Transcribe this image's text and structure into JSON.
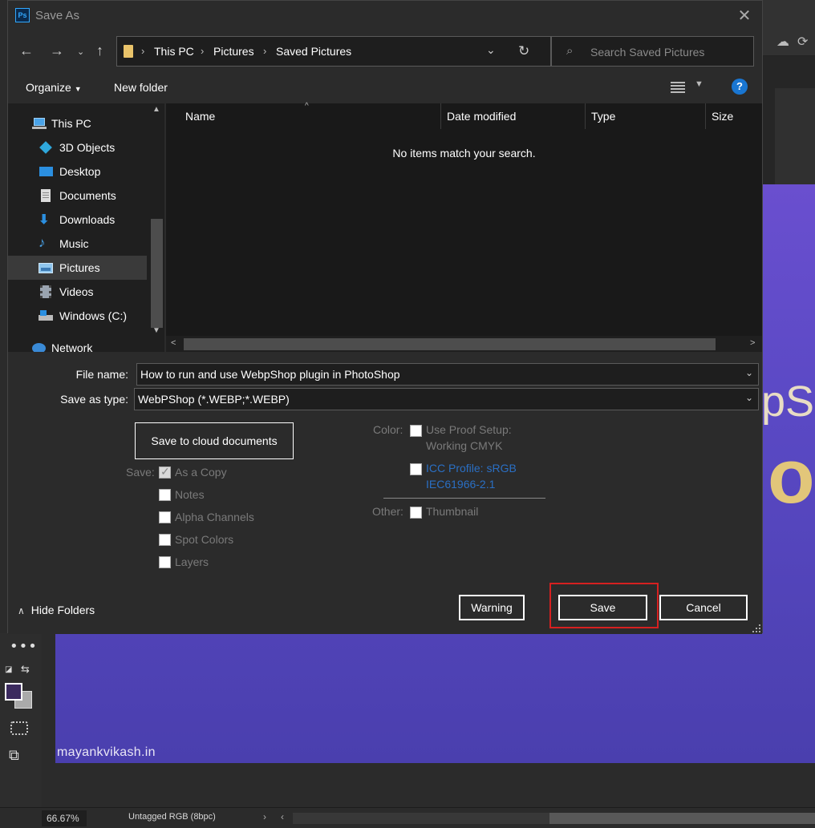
{
  "dialog": {
    "title": "Save As",
    "app_icon_text": "Ps"
  },
  "navigation": {
    "breadcrumbs": [
      "This PC",
      "Pictures",
      "Saved Pictures"
    ],
    "search_placeholder": "Search Saved Pictures"
  },
  "commands": {
    "organize": "Organize",
    "new_folder": "New folder",
    "help_label": "?"
  },
  "sidebar": {
    "items": [
      {
        "label": "This PC",
        "icon": "computer-icon",
        "level": "top"
      },
      {
        "label": "3D Objects",
        "icon": "cube-icon",
        "level": "child"
      },
      {
        "label": "Desktop",
        "icon": "desktop-icon",
        "level": "child"
      },
      {
        "label": "Documents",
        "icon": "document-icon",
        "level": "child"
      },
      {
        "label": "Downloads",
        "icon": "download-icon",
        "level": "child"
      },
      {
        "label": "Music",
        "icon": "music-icon",
        "level": "child"
      },
      {
        "label": "Pictures",
        "icon": "pictures-icon",
        "level": "child",
        "selected": true
      },
      {
        "label": "Videos",
        "icon": "video-icon",
        "level": "child"
      },
      {
        "label": "Windows (C:)",
        "icon": "drive-icon",
        "level": "child"
      },
      {
        "label": "Network",
        "icon": "network-icon",
        "level": "top"
      }
    ]
  },
  "file_list": {
    "columns": [
      "Name",
      "Date modified",
      "Type",
      "Size"
    ],
    "empty_message": "No items match your search."
  },
  "form": {
    "file_name_label": "File name:",
    "file_name_value": "How to run and use WebpShop plugin in PhotoShop",
    "save_type_label": "Save as type:",
    "save_type_value": "WebPShop (*.WEBP;*.WEBP)",
    "cloud_button": "Save to cloud documents",
    "save_label": "Save:",
    "save_options": [
      {
        "label": "As a Copy",
        "checked": true
      },
      {
        "label": "Notes",
        "checked": false
      },
      {
        "label": "Alpha Channels",
        "checked": false
      },
      {
        "label": "Spot Colors",
        "checked": false
      },
      {
        "label": "Layers",
        "checked": false
      }
    ],
    "color_label": "Color:",
    "use_proof_setup": "Use Proof Setup:",
    "working_cmyk": "Working CMYK",
    "icc_profile_line1": "ICC Profile:  sRGB",
    "icc_profile_line2": "IEC61966-2.1",
    "other_label": "Other:",
    "thumbnail": "Thumbnail"
  },
  "footer": {
    "hide_folders": "Hide Folders",
    "warning_button": "Warning",
    "save_button": "Save",
    "cancel_button": "Cancel"
  },
  "photoshop": {
    "watermark": "mayankvikash.in",
    "canvas_text_1": "pS",
    "canvas_text_2": "o",
    "zoom": "66.67%",
    "doc_info": "Untagged RGB (8bpc)"
  },
  "colors": {
    "accent_highlight": "#d62020",
    "link_blue": "#2a6fc4",
    "canvas_purple": "#5a49c4"
  }
}
